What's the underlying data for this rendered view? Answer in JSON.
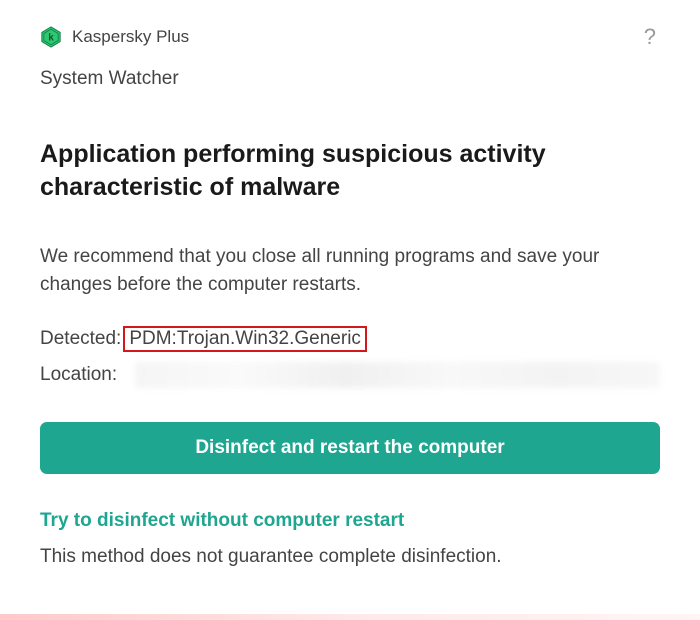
{
  "header": {
    "product_name": "Kaspersky Plus",
    "help_glyph": "?"
  },
  "subtitle": "System Watcher",
  "alert": {
    "title": "Application performing suspicious activity characteristic of malware",
    "recommendation": "We recommend that you close all running programs and save your changes before the computer restarts."
  },
  "detection": {
    "label": "Detected:",
    "value": "PDM:Trojan.Win32.Generic"
  },
  "location": {
    "label": "Location:"
  },
  "actions": {
    "primary": "Disinfect and restart the computer",
    "secondary_link": "Try to disinfect without computer restart",
    "secondary_note": "This method does not guarantee complete disinfection."
  },
  "colors": {
    "accent": "#1ea690",
    "highlight_border": "#d21818"
  }
}
